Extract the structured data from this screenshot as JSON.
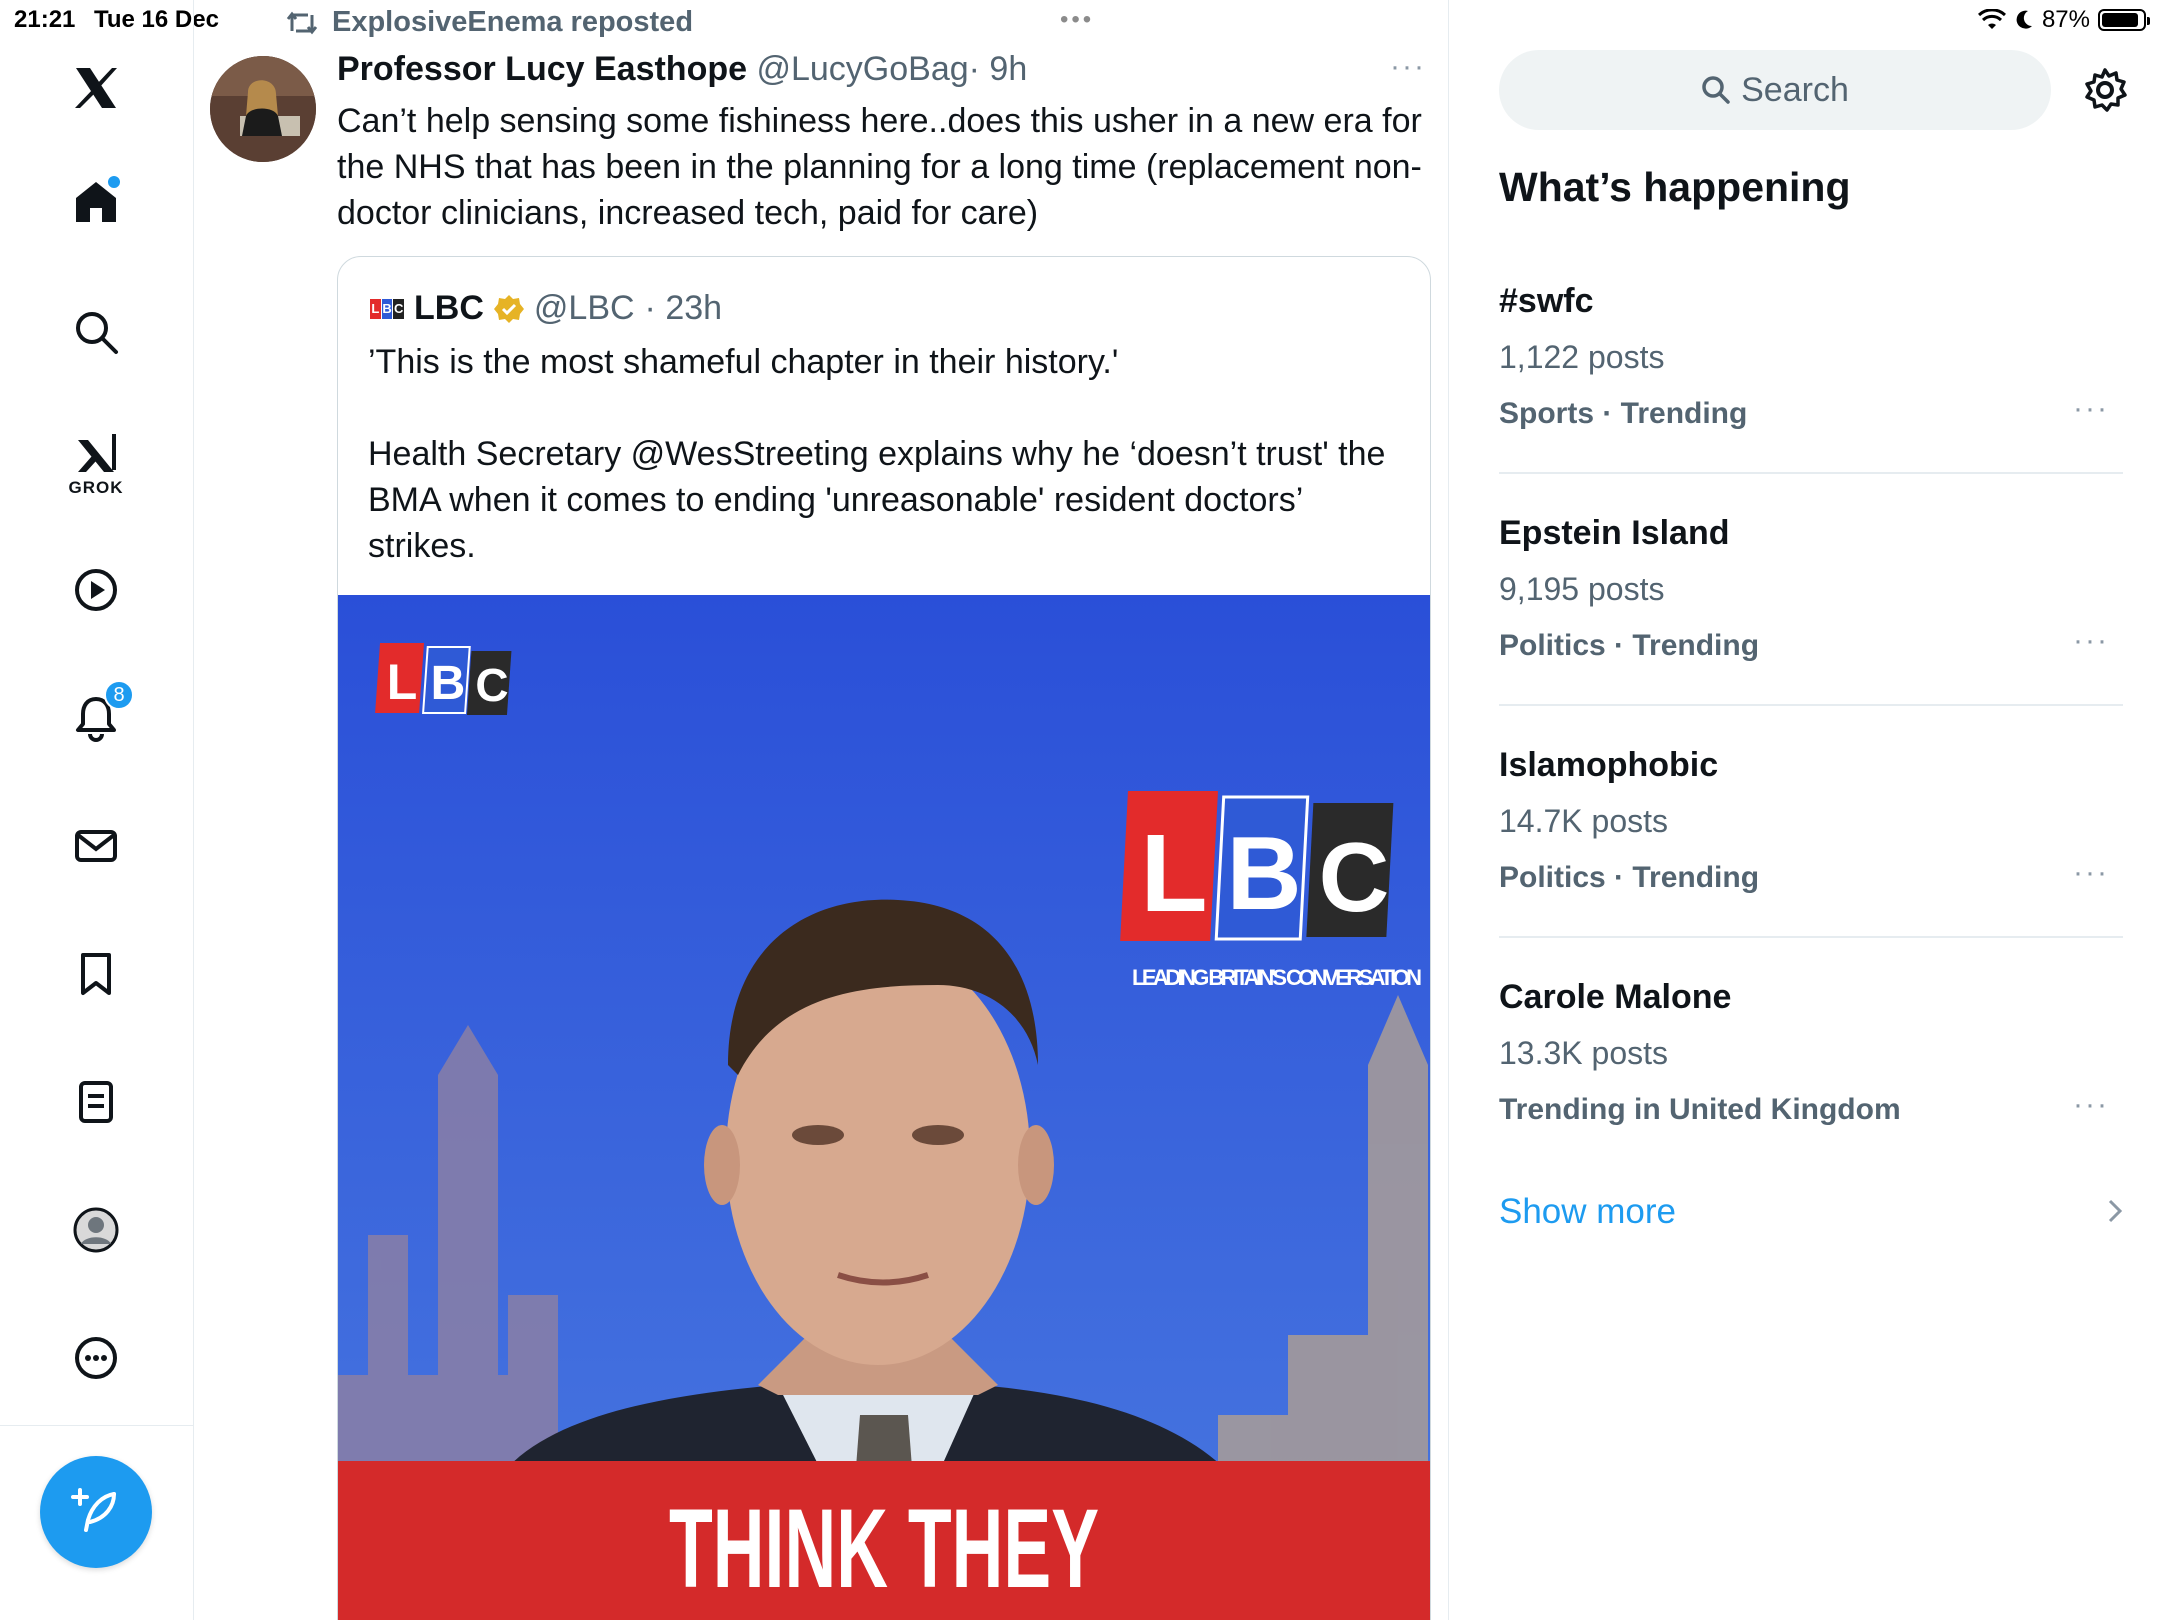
{
  "status_bar": {
    "time": "21:21",
    "date": "Tue 16 Dec",
    "battery": "87%"
  },
  "nav": {
    "grok_label": "GROK",
    "notifications_count": "8"
  },
  "post": {
    "repost_label": "ExplosiveEnema reposted",
    "author_name": "Professor Lucy Easthope",
    "author_handle": "@LucyGoBag",
    "time": "· 9h",
    "more": "···",
    "text": "Can’t help sensing some fishiness here..does this usher in a new era for the NHS that has been in the planning for a long time (replacement non-doctor clinicians, increased tech, paid for care)"
  },
  "quote": {
    "author_name": "LBC",
    "author_handle": "@LBC",
    "time": "· 23h",
    "text": "’This is the most shameful chapter in their history.'\n\nHealth Secretary @WesStreeting explains why he ‘doesn’t trust' the BMA when it comes to ending 'unreasonable' resident doctors’ strikes.",
    "image": {
      "logo_letters": [
        "L",
        "B",
        "C"
      ],
      "tagline": "LEADING BRITAIN'S CONVERSATION",
      "caption": "THINK THEY"
    }
  },
  "sidebar": {
    "search_placeholder": "Search",
    "section_title": "What’s happening",
    "trends": [
      {
        "name": "#swfc",
        "count": "1,122 posts",
        "category": "Sports · Trending"
      },
      {
        "name": "Epstein Island",
        "count": "9,195 posts",
        "category": "Politics · Trending"
      },
      {
        "name": "Islamophobic",
        "count": "14.7K posts",
        "category": "Politics · Trending"
      },
      {
        "name": "Carole Malone",
        "count": "13.3K posts",
        "category": "Trending in United Kingdom"
      }
    ],
    "trend_more": "···",
    "show_more": "Show more"
  },
  "colors": {
    "accent": "#1d9bf0",
    "lbc_red": "#e32b2b",
    "lbc_blue": "#2f5ad6",
    "caption_red": "#d42a2a"
  }
}
